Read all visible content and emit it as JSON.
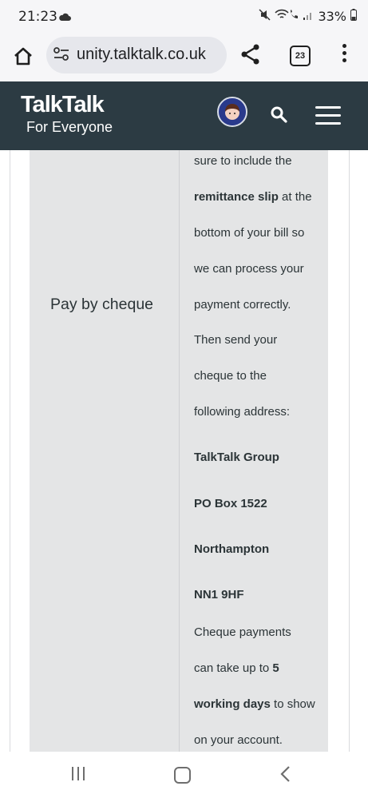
{
  "status_bar": {
    "time": "21:23",
    "battery": "33%"
  },
  "browser": {
    "url": "unity.talktalk.co.uk",
    "tab_count": "23"
  },
  "site_header": {
    "logo": "TalkTalk",
    "tagline": "For Everyone"
  },
  "content": {
    "row_label": "Pay by cheque",
    "lines": [
      {
        "segments": [
          {
            "text": "sure to include the",
            "bold": false
          }
        ]
      },
      {
        "segments": [
          {
            "text": "remittance slip",
            "bold": true
          },
          {
            "text": " at the",
            "bold": false
          }
        ]
      },
      {
        "segments": [
          {
            "text": "bottom of your bill so",
            "bold": false
          }
        ]
      },
      {
        "segments": [
          {
            "text": "we can process your",
            "bold": false
          }
        ]
      },
      {
        "segments": [
          {
            "text": "payment correctly.",
            "bold": false
          }
        ]
      },
      {
        "segments": [
          {
            "text": "Then send your",
            "bold": false
          }
        ]
      },
      {
        "segments": [
          {
            "text": "cheque to the",
            "bold": false
          }
        ]
      },
      {
        "segments": [
          {
            "text": "following address:",
            "bold": false
          }
        ]
      },
      {
        "segments": [
          {
            "text": "TalkTalk Group",
            "bold": true
          }
        ]
      },
      {
        "segments": [
          {
            "text": "PO Box 1522",
            "bold": true
          }
        ]
      },
      {
        "segments": [
          {
            "text": "Northampton",
            "bold": true
          }
        ]
      },
      {
        "segments": [
          {
            "text": "NN1 9HF",
            "bold": true
          }
        ]
      },
      {
        "segments": [
          {
            "text": "Cheque payments",
            "bold": false
          }
        ]
      },
      {
        "segments": [
          {
            "text": "can take up to ",
            "bold": false
          },
          {
            "text": "5",
            "bold": true
          }
        ]
      },
      {
        "segments": [
          {
            "text": "working days",
            "bold": true
          },
          {
            "text": " to show",
            "bold": false
          }
        ]
      },
      {
        "segments": [
          {
            "text": "on your account.",
            "bold": false
          }
        ]
      }
    ]
  },
  "colors": {
    "header_bg": "#2c3b43",
    "table_bg": "#e4e5e6",
    "text": "#2b3437"
  }
}
